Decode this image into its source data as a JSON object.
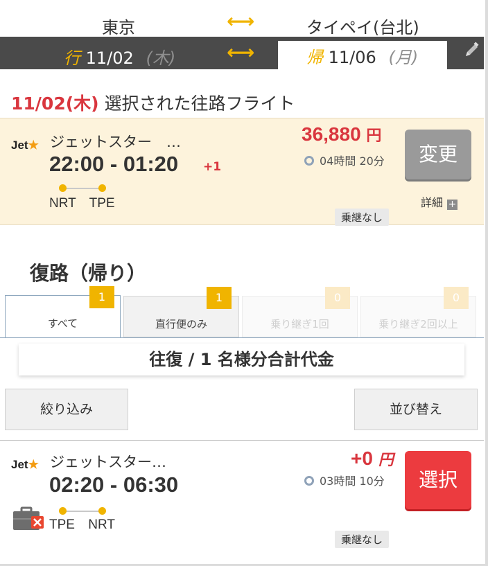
{
  "route": {
    "from": "東京",
    "to": "タイペイ(台北)",
    "swap_glyph": "⟷"
  },
  "dates": {
    "outbound": {
      "kanji": "行",
      "date": "11/02",
      "weekday": "(木)"
    },
    "return": {
      "kanji": "帰",
      "date": "11/06",
      "weekday": "(月)"
    },
    "swap_glyph": "⟷"
  },
  "selected_outbound": {
    "title_date": "11/02(木)",
    "title_text": " 選択された往路フライト",
    "logo": "Jet",
    "logo_star": "★",
    "airline": "ジェットスター　…",
    "times": "22:00 - 01:20",
    "day_offset": "+1",
    "origin": "NRT",
    "destination": "TPE",
    "price": "36,880",
    "currency": "円",
    "duration": "04時間 20分",
    "stops": "乗継なし",
    "change_label": "変更",
    "detail_label": "詳細",
    "detail_plus": "+"
  },
  "return_section": {
    "title": "復路（帰り）",
    "tabs": [
      {
        "label": "すべて",
        "count": "1",
        "state": "active"
      },
      {
        "label": "直行便のみ",
        "count": "1",
        "state": "normal"
      },
      {
        "label": "乗り継ぎ1回",
        "count": "0",
        "state": "disabled"
      },
      {
        "label": "乗り継ぎ2回以上",
        "count": "0",
        "state": "disabled"
      }
    ],
    "total_label": "往復 / 1 名様分合計代金",
    "filter_label": "絞り込み",
    "sort_label": "並び替え"
  },
  "return_flight": {
    "logo": "Jet",
    "logo_star": "★",
    "airline": "ジェットスター…",
    "times": "02:20 - 06:30",
    "origin": "TPE",
    "destination": "NRT",
    "price": "+0",
    "currency": "円",
    "duration": "03時間 10分",
    "stops": "乗継なし",
    "select_label": "選択",
    "baggage_icon": "no-baggage-icon"
  },
  "colors": {
    "accent_yellow": "#f0b400",
    "price_red": "#d9363e",
    "select_red": "#ec3b3f",
    "dark_bar": "#4a4a4a",
    "selected_card_bg": "#fdf3dc"
  }
}
